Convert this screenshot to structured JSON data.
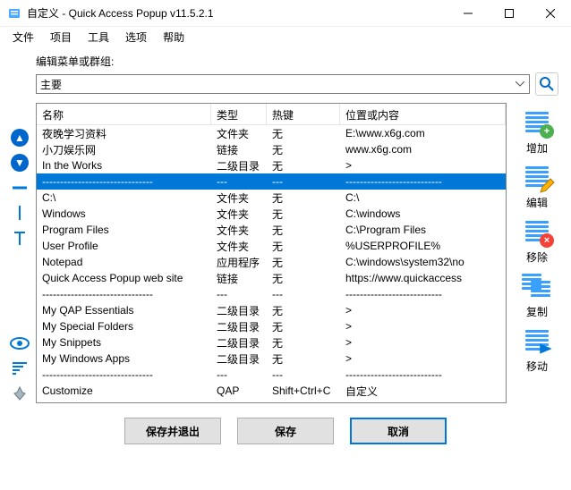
{
  "window": {
    "title": "自定义 - Quick Access Popup v11.5.2.1"
  },
  "menu": {
    "file": "文件",
    "project": "项目",
    "tools": "工具",
    "options": "选项",
    "help": "帮助"
  },
  "toolbar": {
    "label": "编辑菜单或群组:",
    "combo_value": "主要"
  },
  "columns": {
    "name": "名称",
    "type": "类型",
    "hotkey": "热键",
    "location": "位置或内容"
  },
  "rows": [
    {
      "name": "夜晚学习资料",
      "type": "文件夹",
      "hotkey": "无",
      "loc": "E:\\www.x6g.com"
    },
    {
      "name": "小刀娱乐网",
      "type": "链接",
      "hotkey": "无",
      "loc": "www.x6g.com"
    },
    {
      "name": "In the Works",
      "type": "二级目录",
      "hotkey": "无",
      "loc": ">"
    },
    {
      "name": "-------------------------------",
      "type": "---",
      "hotkey": "---",
      "loc": "---------------------------",
      "selected": true
    },
    {
      "name": "C:\\",
      "type": "文件夹",
      "hotkey": "无",
      "loc": "C:\\"
    },
    {
      "name": "Windows",
      "type": "文件夹",
      "hotkey": "无",
      "loc": "C:\\windows"
    },
    {
      "name": "Program Files",
      "type": "文件夹",
      "hotkey": "无",
      "loc": "C:\\Program Files"
    },
    {
      "name": "User Profile",
      "type": "文件夹",
      "hotkey": "无",
      "loc": "%USERPROFILE%"
    },
    {
      "name": "Notepad",
      "type": "应用程序",
      "hotkey": "无",
      "loc": "C:\\windows\\system32\\no"
    },
    {
      "name": "Quick Access Popup web site",
      "type": "链接",
      "hotkey": "无",
      "loc": "https://www.quickaccess"
    },
    {
      "name": "-------------------------------",
      "type": "---",
      "hotkey": "---",
      "loc": "---------------------------"
    },
    {
      "name": "My QAP Essentials",
      "type": "二级目录",
      "hotkey": "无",
      "loc": ">"
    },
    {
      "name": "My Special Folders",
      "type": "二级目录",
      "hotkey": "无",
      "loc": ">"
    },
    {
      "name": "My Snippets",
      "type": "二级目录",
      "hotkey": "无",
      "loc": ">"
    },
    {
      "name": "My Windows Apps",
      "type": "二级目录",
      "hotkey": "无",
      "loc": ">"
    },
    {
      "name": "-------------------------------",
      "type": "---",
      "hotkey": "---",
      "loc": "---------------------------"
    },
    {
      "name": "Customize",
      "type": "QAP",
      "hotkey": "Shift+Ctrl+C",
      "loc": "自定义"
    },
    {
      "name": "-------------------------------",
      "type": "---",
      "hotkey": "---",
      "loc": "---------------------------"
    }
  ],
  "actions": {
    "add": "增加",
    "edit": "编辑",
    "remove": "移除",
    "copy": "复制",
    "move": "移动"
  },
  "buttons": {
    "save_exit": "保存并退出",
    "save": "保存",
    "cancel": "取消"
  }
}
